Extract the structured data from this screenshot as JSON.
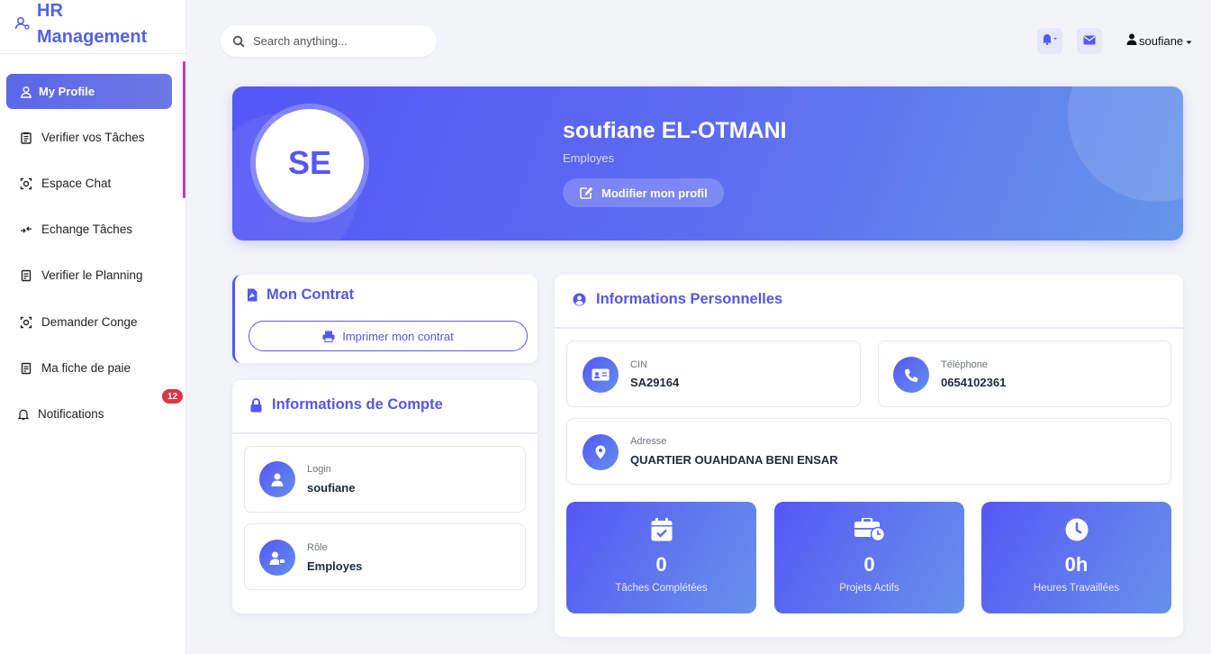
{
  "brand": {
    "line1": "HR",
    "line2": "Management"
  },
  "sidebar": {
    "items": [
      {
        "label": "My Profile",
        "icon": "user-icon",
        "active": true
      },
      {
        "label": "Verifier vos Tâches",
        "icon": "clipboard-icon"
      },
      {
        "label": "Espace Chat",
        "icon": "chat-icon"
      },
      {
        "label": "Echange Tâches",
        "icon": "exchange-icon"
      },
      {
        "label": "Verifier le Planning",
        "icon": "calendar-icon"
      },
      {
        "label": "Demander Conge",
        "icon": "leave-icon"
      },
      {
        "label": "Ma fiche de paie",
        "icon": "payslip-icon"
      },
      {
        "label": "Notifications",
        "icon": "bell-icon"
      }
    ],
    "notifications_badge": "12"
  },
  "topbar": {
    "search_placeholder": "Search anything...",
    "username": "soufiane"
  },
  "profile": {
    "initials": "SE",
    "full_name": "soufiane EL-OTMANI",
    "role": "Employes",
    "edit_label": "Modifier mon profil"
  },
  "contract": {
    "title": "Mon Contrat",
    "print_label": "Imprimer mon contrat"
  },
  "account": {
    "title": "Informations de Compte",
    "login_label": "Login",
    "login_value": "soufiane",
    "role_label": "Rôle",
    "role_value": "Employes"
  },
  "personal": {
    "title": "Informations Personnelles",
    "cin_label": "CIN",
    "cin_value": "SA29164",
    "phone_label": "Téléphone",
    "phone_value": "0654102361",
    "address_label": "Adresse",
    "address_value": "QUARTIER OUAHDANA BENI ENSAR"
  },
  "stats": [
    {
      "value": "0",
      "caption": "Tâches Complétées",
      "icon": "calendar-check-icon"
    },
    {
      "value": "0",
      "caption": "Projets Actifs",
      "icon": "briefcase-clock-icon"
    },
    {
      "value": "0h",
      "caption": "Heures Travaillées",
      "icon": "clock-icon"
    }
  ],
  "colors": {
    "accent": "#5457f6",
    "accent_light": "#6595ea",
    "badge": "#dc3545"
  }
}
